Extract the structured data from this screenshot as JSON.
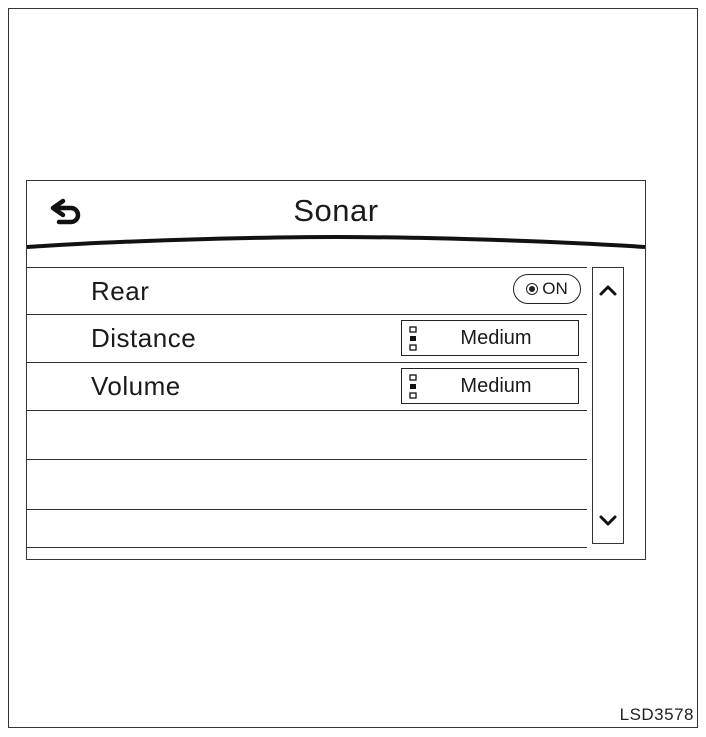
{
  "screen": {
    "title": "Sonar",
    "back_icon": "back-arrow-icon",
    "rows": [
      {
        "label": "Rear",
        "control": "toggle",
        "value": "ON"
      },
      {
        "label": "Distance",
        "control": "selector",
        "value": "Medium",
        "icon": "level-indicator-icon"
      },
      {
        "label": "Volume",
        "control": "selector",
        "value": "Medium",
        "icon": "level-indicator-icon"
      },
      {
        "label": ""
      },
      {
        "label": ""
      },
      {
        "label": ""
      }
    ],
    "scroll_up_icon": "chevron-up-icon",
    "scroll_down_icon": "chevron-down-icon"
  },
  "figure_code": "LSD3578"
}
